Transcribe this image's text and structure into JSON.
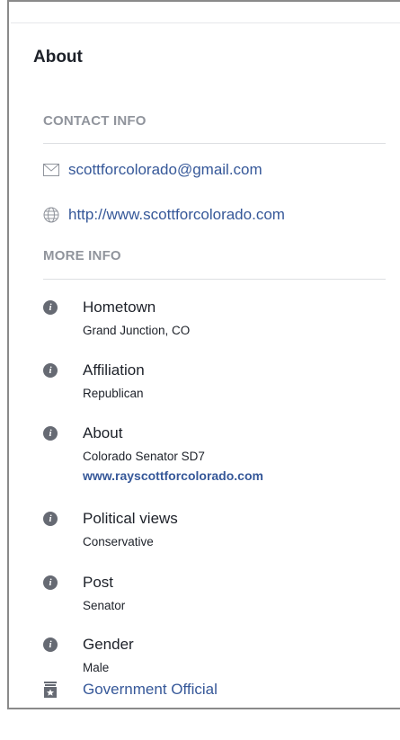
{
  "about": {
    "title": "About",
    "contact_info": {
      "header": "CONTACT INFO",
      "email": "scottforcolorado@gmail.com",
      "website": "http://www.scottforcolorado.com"
    },
    "more_info": {
      "header": "MORE INFO",
      "items": [
        {
          "label": "Hometown",
          "value": "Grand Junction, CO"
        },
        {
          "label": "Affiliation",
          "value": "Republican"
        },
        {
          "label": "About",
          "value": "Colorado Senator SD7",
          "link": "www.rayscottforcolorado.com"
        },
        {
          "label": "Political views",
          "value": "Conservative"
        },
        {
          "label": "Post",
          "value": "Senator"
        },
        {
          "label": "Gender",
          "value": "Male"
        }
      ]
    },
    "category": "Government Official"
  }
}
